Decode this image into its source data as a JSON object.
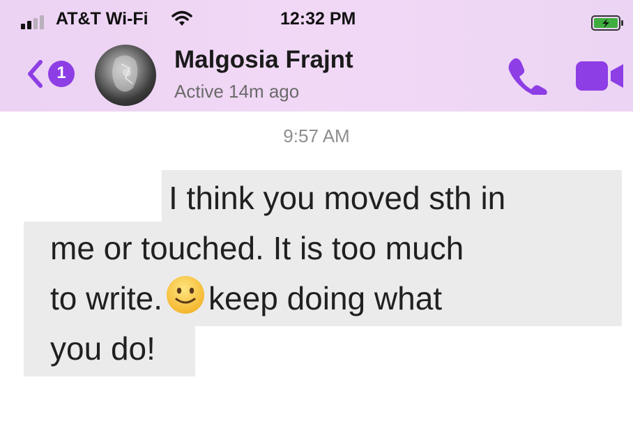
{
  "status_bar": {
    "carrier": "AT&T Wi-Fi",
    "time": "12:32 PM"
  },
  "header": {
    "back_badge": "1",
    "contact_name": "Malgosia Frajnt",
    "active_status": "Active 14m ago"
  },
  "conversation": {
    "timestamp": "9:57 AM",
    "message": {
      "line1": "I think you moved sth in",
      "line2": "me or touched. It is too much",
      "line3_before": "to write.",
      "line3_after": "keep doing what",
      "line4": "you do!",
      "emoji": "slightly-smiling-face-emoji"
    }
  },
  "colors": {
    "accent": "#8d3ee4",
    "header_bg": "#efd6f5",
    "bubble_bg": "#ebebeb",
    "battery": "#3fae3f"
  }
}
